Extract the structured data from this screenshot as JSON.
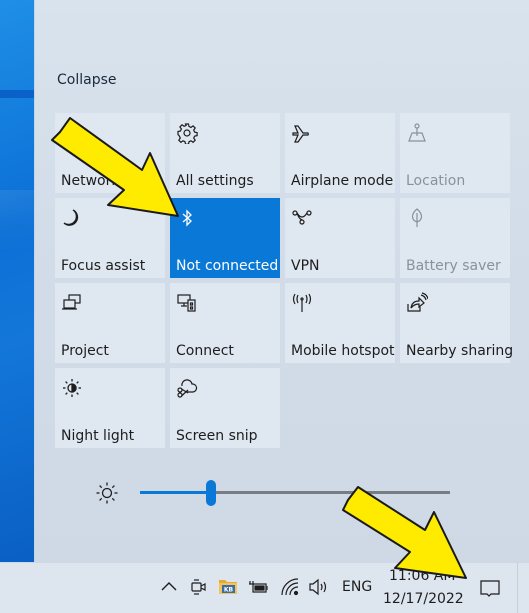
{
  "action_center": {
    "collapse_label": "Collapse",
    "tiles": [
      {
        "label": "Network",
        "icon": "network-icon",
        "state": "normal"
      },
      {
        "label": "All settings",
        "icon": "gear-icon",
        "state": "normal"
      },
      {
        "label": "Airplane mode",
        "icon": "airplane-icon",
        "state": "normal"
      },
      {
        "label": "Location",
        "icon": "location-icon",
        "state": "disabled"
      },
      {
        "label": "Focus assist",
        "icon": "moon-icon",
        "state": "normal"
      },
      {
        "label": "Not connected",
        "icon": "bluetooth-icon",
        "state": "active"
      },
      {
        "label": "VPN",
        "icon": "vpn-icon",
        "state": "normal"
      },
      {
        "label": "Battery saver",
        "icon": "leaf-icon",
        "state": "disabled"
      },
      {
        "label": "Project",
        "icon": "project-icon",
        "state": "normal"
      },
      {
        "label": "Connect",
        "icon": "connect-icon",
        "state": "normal"
      },
      {
        "label": "Mobile hotspot",
        "icon": "hotspot-icon",
        "state": "normal"
      },
      {
        "label": "Nearby sharing",
        "icon": "nearby-sharing-icon",
        "state": "normal"
      },
      {
        "label": "Night light",
        "icon": "night-light-icon",
        "state": "normal"
      },
      {
        "label": "Screen snip",
        "icon": "screen-snip-icon",
        "state": "normal"
      }
    ],
    "brightness": {
      "icon": "brightness-icon",
      "value_percent": 23
    }
  },
  "taskbar": {
    "tray_icons": [
      "chevron-up-icon",
      "camera-icon",
      "kb-folder-icon",
      "power-battery-icon",
      "wifi-icon",
      "speaker-icon"
    ],
    "language": "ENG",
    "time": "11:06 AM",
    "date": "12/17/2022",
    "notification_icon": "notification-icon"
  },
  "annotations": {
    "arrow_color": "#ffeb00",
    "arrows": [
      "arrow-pointing-bluetooth-tile",
      "arrow-pointing-notification-button"
    ]
  },
  "colors": {
    "accent": "#0a78d7",
    "tile_bg": "#dfe7f1",
    "disabled_text": "#8a919a"
  }
}
